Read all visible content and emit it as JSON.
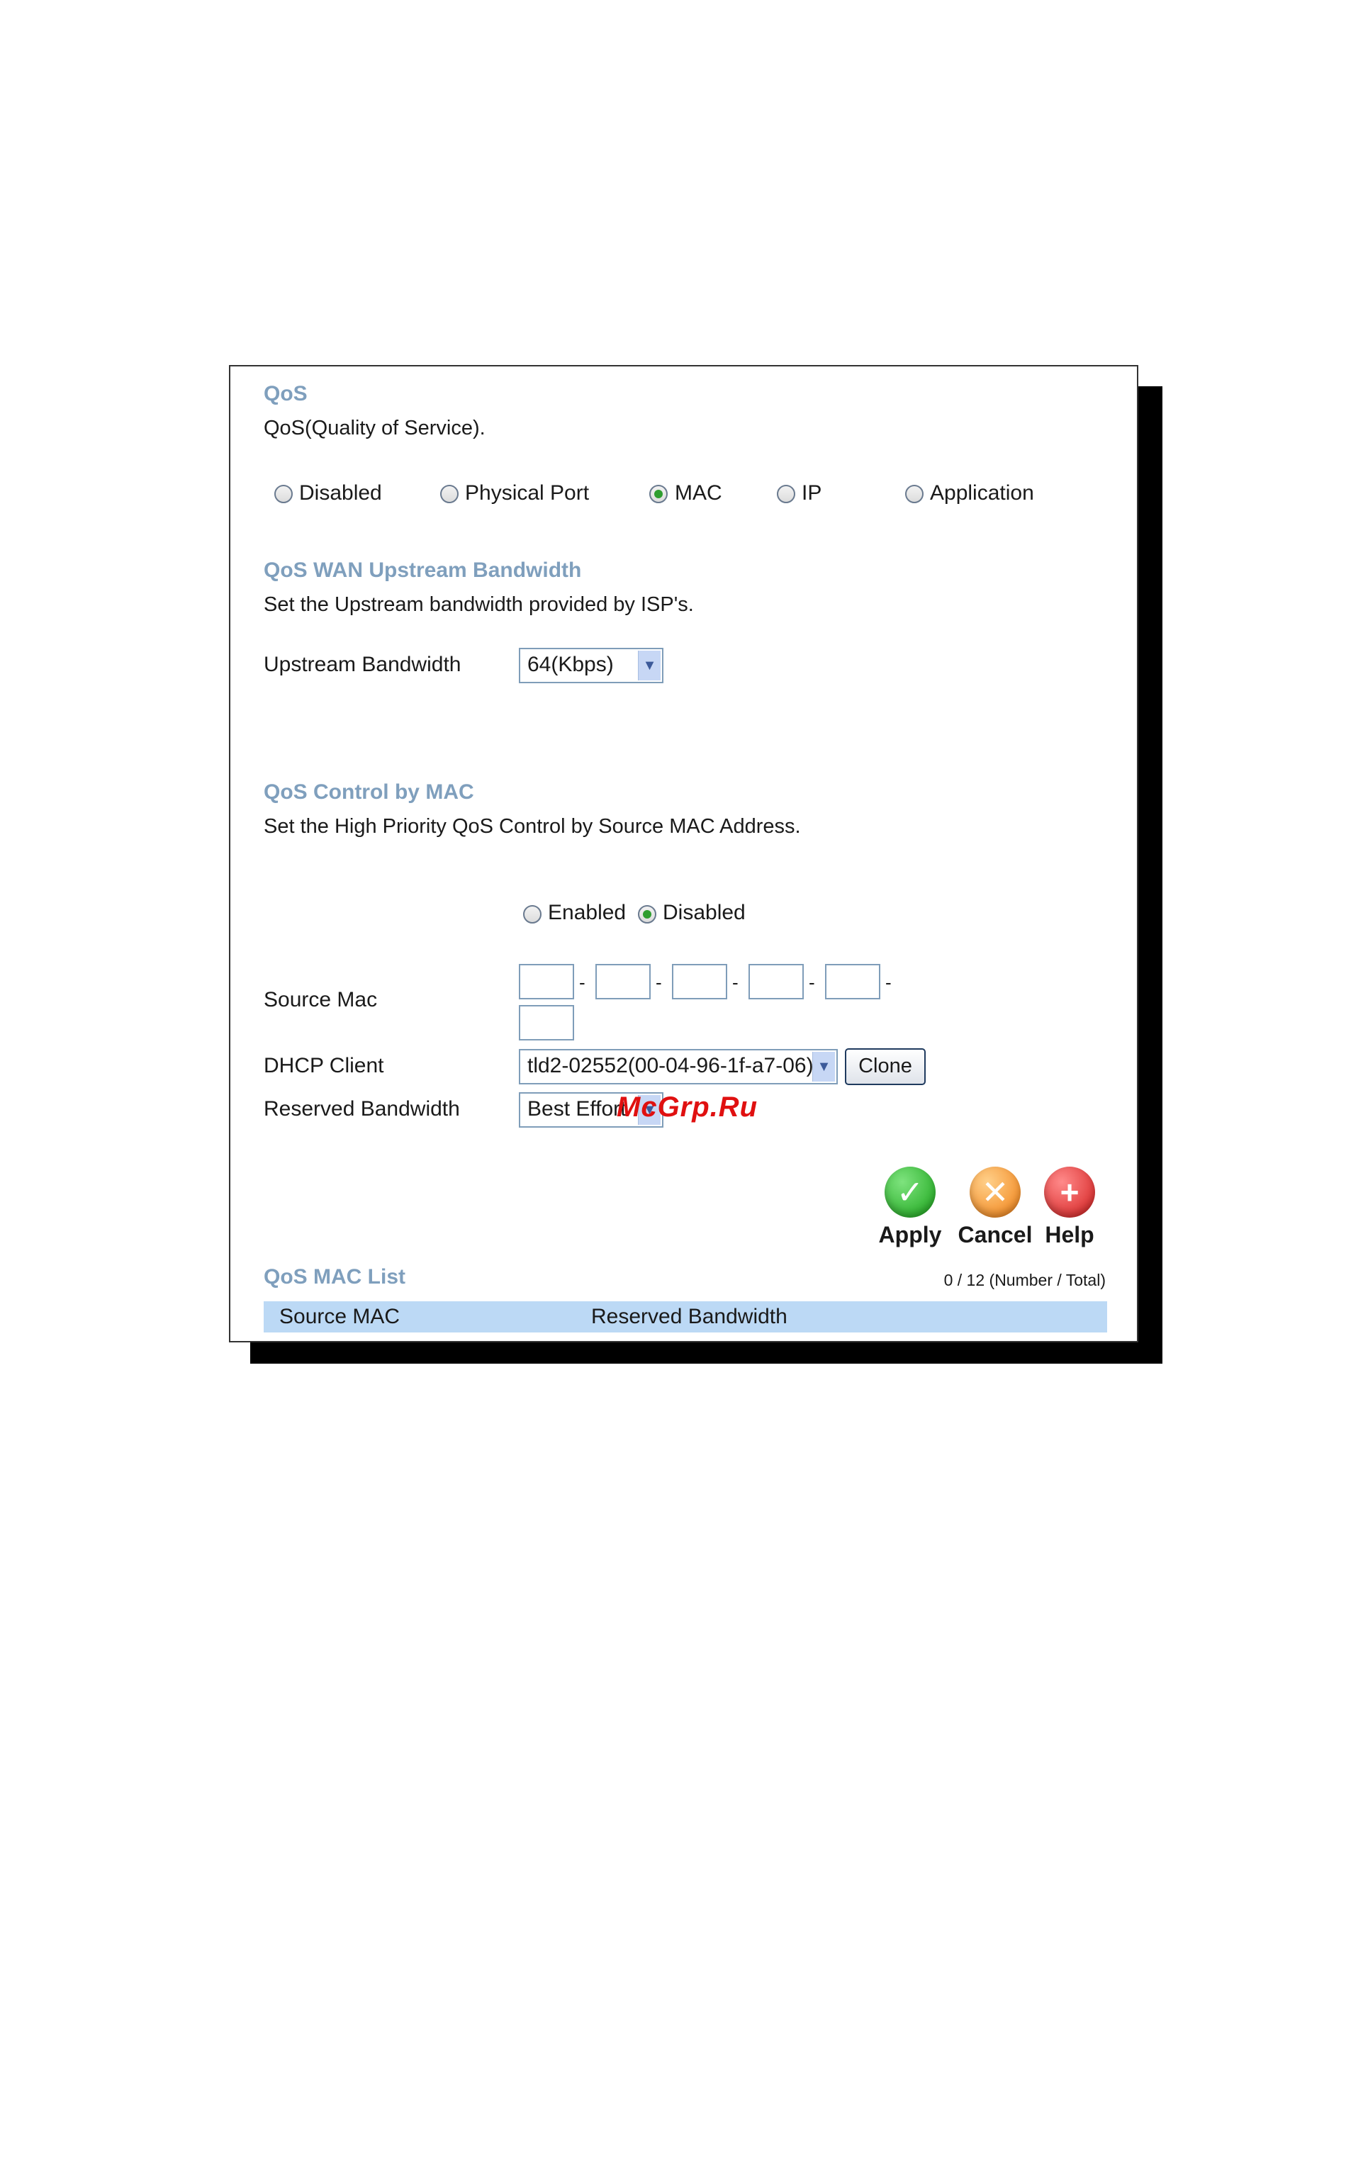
{
  "qos": {
    "title": "QoS",
    "description": "QoS(Quality of Service).",
    "modes": [
      {
        "label": "Disabled",
        "selected": false
      },
      {
        "label": "Physical Port",
        "selected": false
      },
      {
        "label": "MAC",
        "selected": true
      },
      {
        "label": "IP",
        "selected": false
      },
      {
        "label": "Application",
        "selected": false
      }
    ]
  },
  "wan": {
    "title": "QoS WAN Upstream Bandwidth",
    "description": "Set the Upstream bandwidth provided by ISP's.",
    "upstream_label": "Upstream Bandwidth",
    "upstream_value": "64(Kbps)"
  },
  "mac_control": {
    "title": "QoS Control by MAC",
    "description": "Set the High Priority QoS Control by Source MAC Address.",
    "enabled_label": "Enabled",
    "disabled_label": "Disabled",
    "selected": "Disabled",
    "source_mac_label": "Source Mac",
    "mac_separator": "-",
    "dhcp_client_label": "DHCP Client",
    "dhcp_client_value": "tld2-02552(00-04-96-1f-a7-06)",
    "clone_label": "Clone",
    "reserved_bandwidth_label": "Reserved Bandwidth",
    "reserved_bandwidth_value": "Best Effort"
  },
  "actions": {
    "apply": "Apply",
    "cancel": "Cancel",
    "help": "Help"
  },
  "mac_list": {
    "title": "QoS MAC List",
    "count": "0 / 12 (Number / Total)",
    "columns": [
      "Source MAC",
      "Reserved Bandwidth"
    ]
  },
  "watermark": "McGrp.Ru",
  "colors": {
    "section_title": "#7f9fbd",
    "list_header_bg": "#bcd9f5",
    "watermark": "#e01010"
  }
}
